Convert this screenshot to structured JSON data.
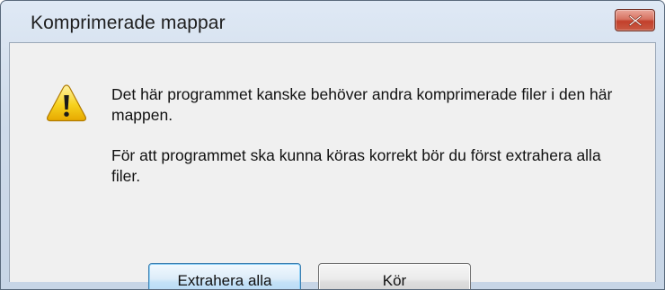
{
  "dialog": {
    "title": "Komprimerade mappar",
    "close_icon": "close-icon",
    "warning_icon": "warning-icon",
    "message_1": "Det här programmet kanske behöver andra komprimerade filer i den här mappen.",
    "message_2": "För att programmet ska kunna köras korrekt bör du först extrahera alla filer.",
    "buttons": {
      "extract_all": "Extrahera alla",
      "run": "Kör"
    },
    "colors": {
      "close_button": "#c95a43",
      "default_button_border": "#3c7fb1",
      "warning_fill": "#f5c518"
    }
  }
}
